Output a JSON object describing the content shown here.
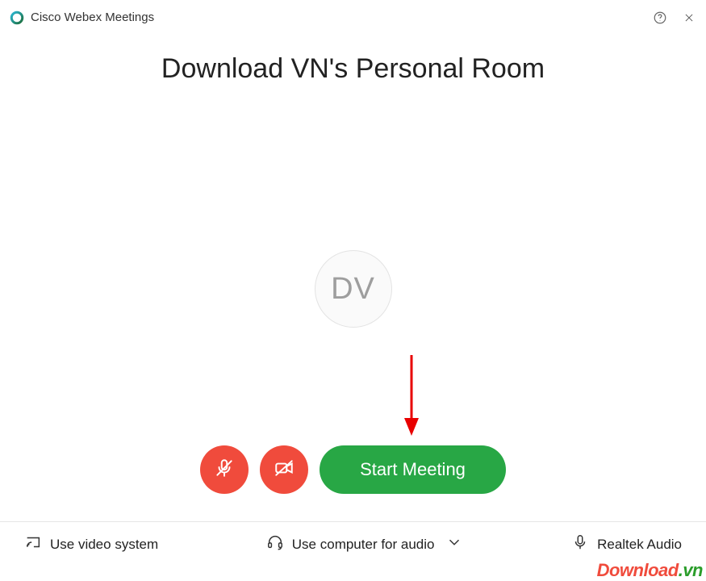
{
  "titlebar": {
    "app_name": "Cisco Webex Meetings"
  },
  "room": {
    "title": "Download VN's Personal Room"
  },
  "avatar": {
    "initials": "DV"
  },
  "controls": {
    "start_label": "Start Meeting"
  },
  "bottom": {
    "video_system_label": "Use video system",
    "audio_mode_label": "Use computer for audio",
    "audio_device_label": "Realtek Audio"
  },
  "annotation": {
    "watermark_main": "Download",
    "watermark_suffix": ".vn"
  },
  "colors": {
    "danger": "#f04b3c",
    "success": "#28a745"
  }
}
